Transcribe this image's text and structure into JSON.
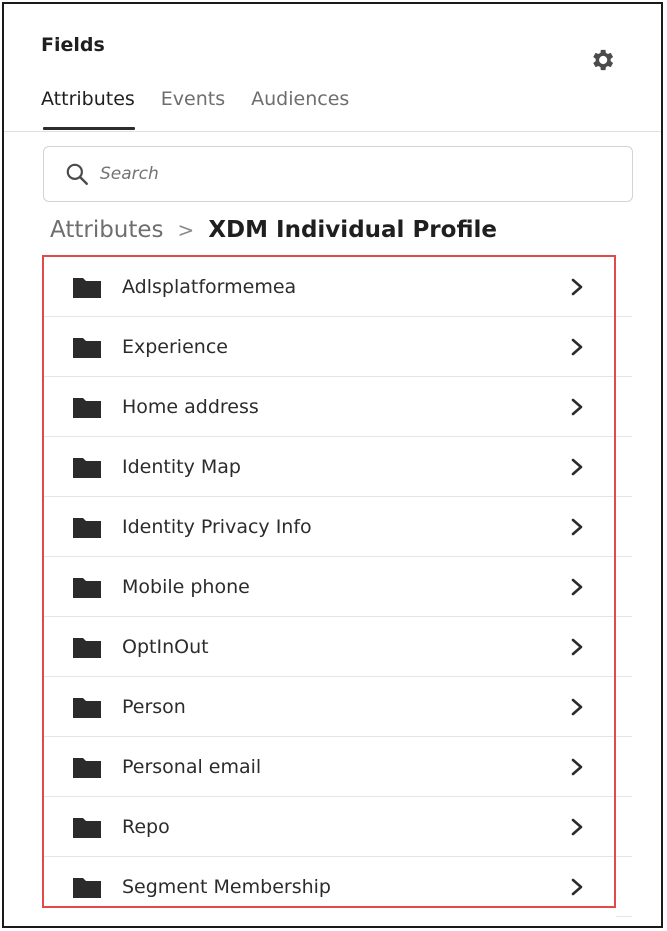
{
  "panel": {
    "title": "Fields",
    "settings_icon": "gear-icon"
  },
  "tabs": [
    {
      "label": "Attributes",
      "active": true
    },
    {
      "label": "Events",
      "active": false
    },
    {
      "label": "Audiences",
      "active": false
    }
  ],
  "search": {
    "placeholder": "Search",
    "value": "",
    "icon": "search-icon"
  },
  "breadcrumb": {
    "root": "Attributes",
    "separator": ">",
    "current": "XDM Individual Profile"
  },
  "list": {
    "folder_icon": "folder-icon",
    "chevron_icon": "chevron-right-icon",
    "items": [
      {
        "label": "Adlsplatformemea"
      },
      {
        "label": "Experience"
      },
      {
        "label": "Home address"
      },
      {
        "label": "Identity Map"
      },
      {
        "label": "Identity Privacy Info"
      },
      {
        "label": "Mobile phone"
      },
      {
        "label": "OptInOut"
      },
      {
        "label": "Person"
      },
      {
        "label": "Personal email"
      },
      {
        "label": "Repo"
      },
      {
        "label": "Segment Membership"
      }
    ]
  },
  "colors": {
    "highlight_border": "#e04a4a",
    "text_primary": "#1f1f1f",
    "text_secondary": "#6e6e6e"
  }
}
